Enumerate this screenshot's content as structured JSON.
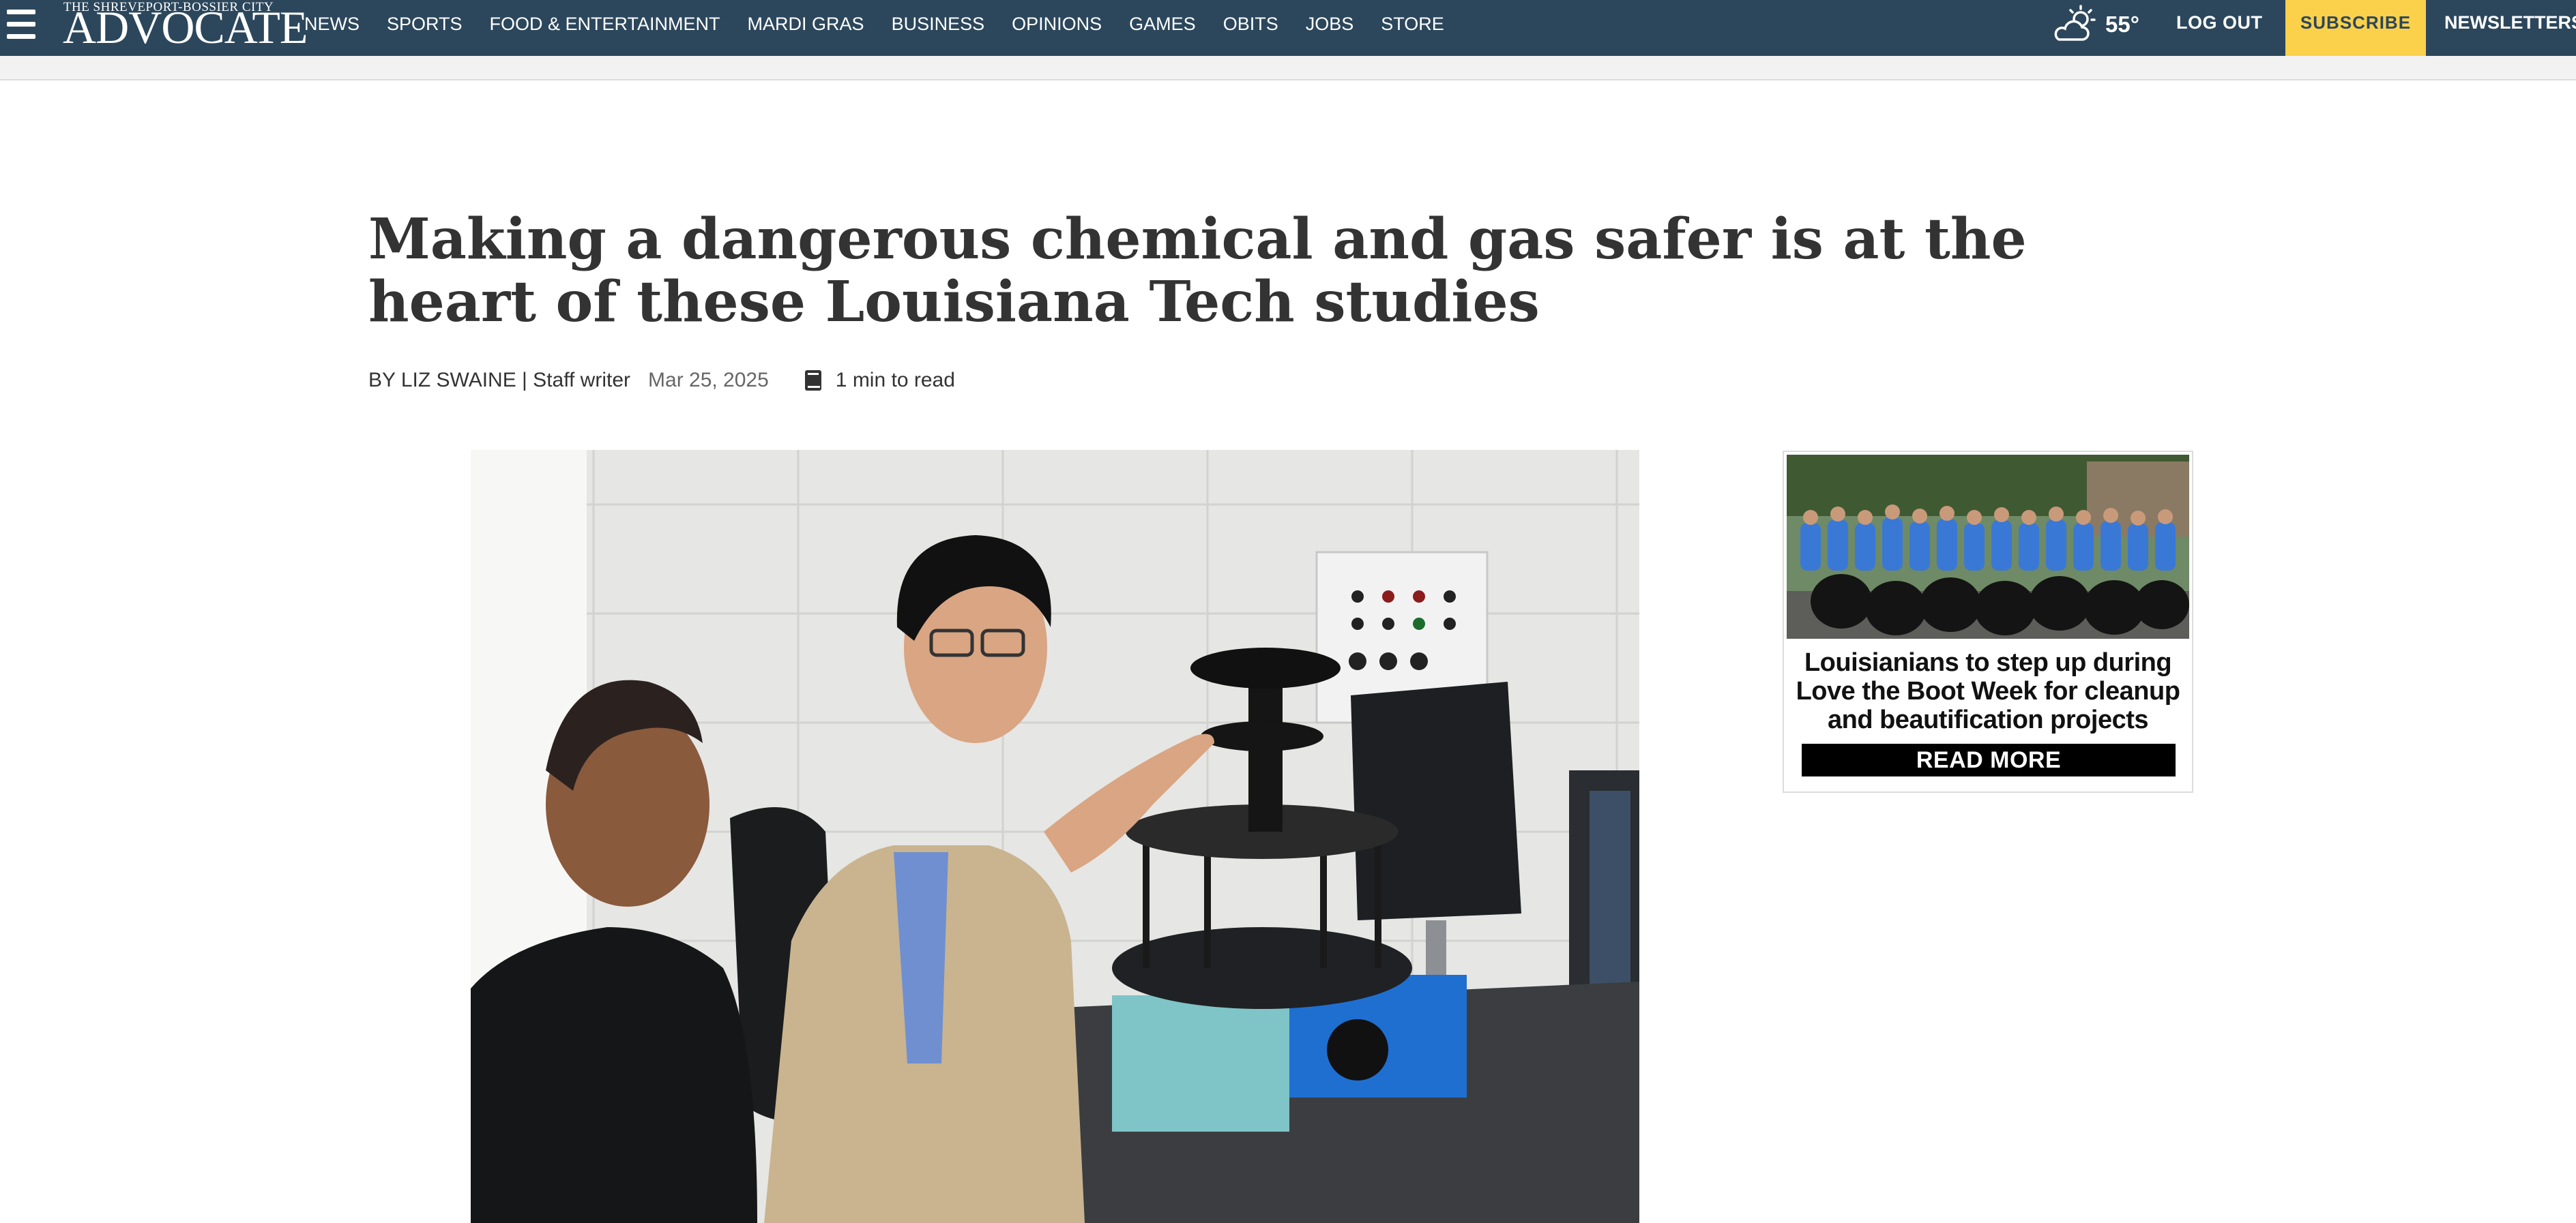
{
  "header": {
    "logo_kicker": "THE SHREVEPORT-BOSSIER CITY",
    "logo_main": "ADVOCATE",
    "nav": [
      "NEWS",
      "SPORTS",
      "FOOD & ENTERTAINMENT",
      "MARDI GRAS",
      "BUSINESS",
      "OPINIONS",
      "GAMES",
      "OBITS",
      "JOBS",
      "STORE"
    ],
    "weather_icon": "partly-cloudy-sun-icon",
    "temperature": "55°",
    "logout_label": "LOG OUT",
    "subscribe_label": "SUBSCRIBE",
    "newsletters_label": "NEWSLETTERS"
  },
  "article": {
    "headline": "Making a dangerous chemical and gas safer is at the heart of these Louisiana Tech studies",
    "byline": "BY LIZ SWAINE | Staff writer",
    "date": "Mar 25, 2025",
    "read_time_icon": "book-icon",
    "read_time": "1 min to read"
  },
  "ad": {
    "text": "Louisianians to step up during Love the Boot Week for cleanup and beautification projects",
    "button_label": "READ MORE"
  },
  "colors": {
    "nav_background": "#2c475c",
    "subscribe_background": "#fbd14b",
    "ad_button_background": "#000000"
  }
}
